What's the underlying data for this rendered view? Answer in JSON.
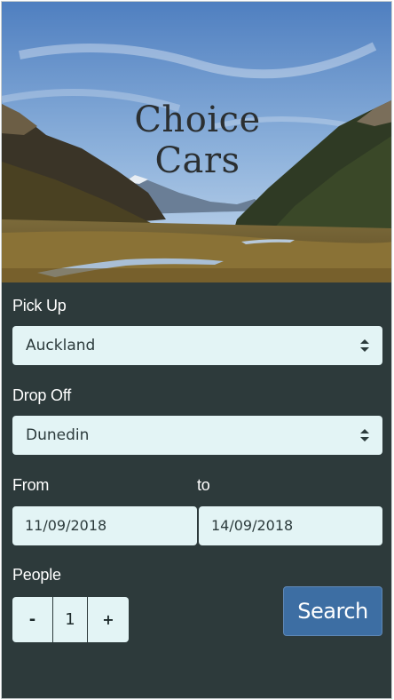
{
  "hero": {
    "title_line1": "Choice",
    "title_line2": "Cars"
  },
  "form": {
    "pickup_label": "Pick Up",
    "pickup_value": "Auckland",
    "dropoff_label": "Drop Off",
    "dropoff_value": "Dunedin",
    "from_label": "From",
    "to_label": "to",
    "from_date": "11/09/2018",
    "to_date": "14/09/2018",
    "people_label": "People",
    "people_minus": "-",
    "people_count": "1",
    "people_plus": "+",
    "search_label": "Search"
  },
  "icons": {
    "select_arrows": "up-down-caret-icon"
  },
  "colors": {
    "panel_background": "#2d3a3b",
    "field_background": "#e3f4f5",
    "search_button": "#3d6ea3",
    "label_text": "#ffffff"
  }
}
